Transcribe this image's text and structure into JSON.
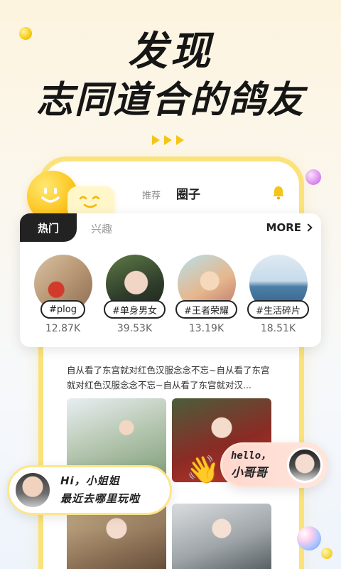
{
  "headline": {
    "line1": "发现",
    "line2": "志同道合的鸽友"
  },
  "phone": {
    "tab_recommend": "推荐",
    "tab_circle": "圈子"
  },
  "hot_card": {
    "tab_hot": "热门",
    "tab_interest": "兴趣",
    "more": "MORE",
    "topics": [
      {
        "tag": "#plog",
        "count": "12.87K"
      },
      {
        "tag": "#单身男女",
        "count": "39.53K"
      },
      {
        "tag": "#王者荣耀",
        "count": "13.19K"
      },
      {
        "tag": "#生活碎片",
        "count": "18.51K"
      }
    ]
  },
  "feed": {
    "text": "自从看了东宫就对红色汉服念念不忘~自从看了东宫就对红色汉服念念不忘~自从看了东宫就对汉..."
  },
  "chat_left": {
    "line1": "Hi，小姐姐",
    "line2": "最近去哪里玩啦"
  },
  "chat_right": {
    "line1": "hello，",
    "line2": "小哥哥",
    "emoji": "👋"
  },
  "colors": {
    "accent": "#f6c514",
    "frame": "#fbe27a",
    "text_dark": "#161616"
  }
}
